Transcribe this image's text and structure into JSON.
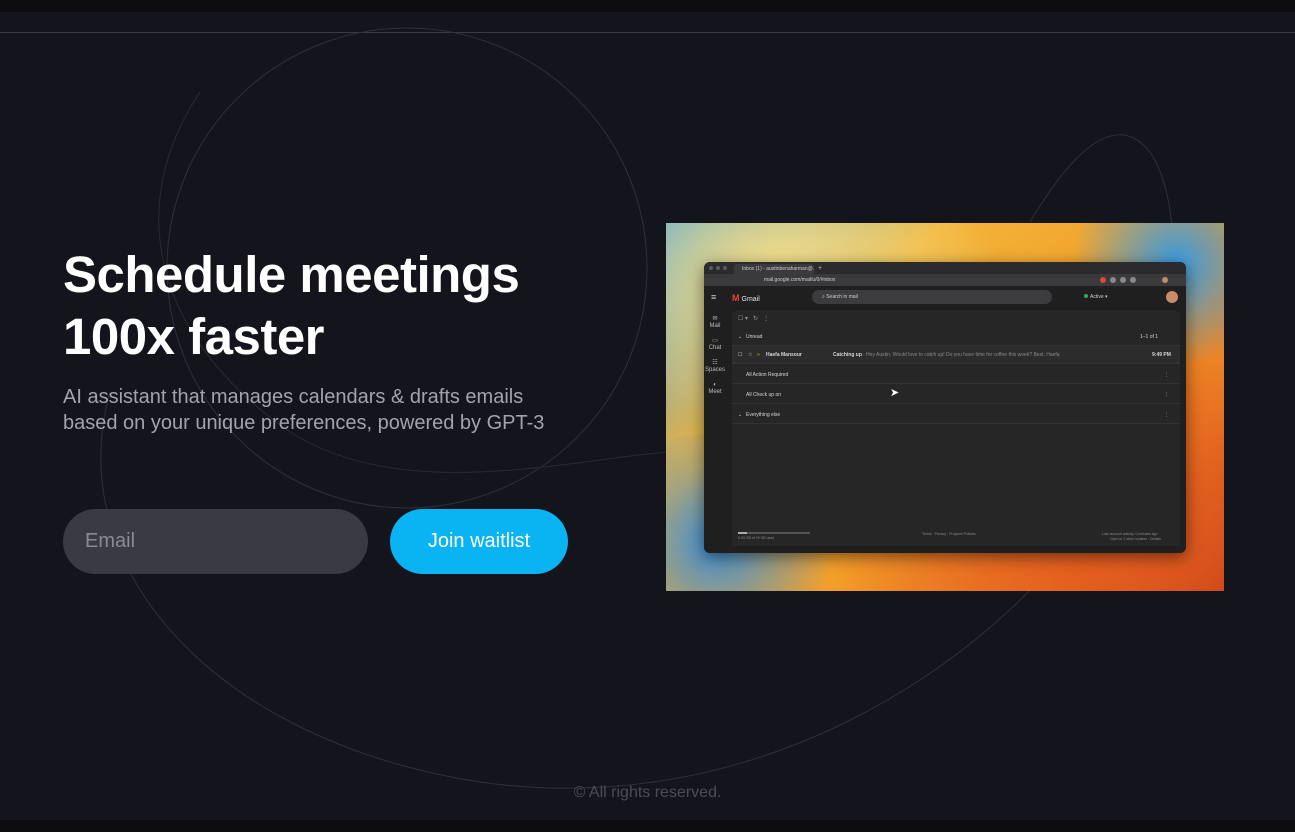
{
  "hero": {
    "title_line1": "Schedule meetings",
    "title_line2": "100x faster",
    "subtitle": "AI assistant that manages calendars & drafts emails based on your unique preferences, powered by GPT-3"
  },
  "form": {
    "email_placeholder": "Email",
    "join_label": "Join waitlist"
  },
  "footer": {
    "text": "© All rights reserved."
  },
  "colors": {
    "background": "#14141c",
    "cta": "#0ab4f2",
    "input": "#3a3a42",
    "title": "#ffffff",
    "subtitle": "#a3a3ad"
  },
  "preview": {
    "tab_title": "Inbox (1) - austinbenaharman@...",
    "url": "mail.google.com/mail/u/0/#inbox",
    "app_name": "Gmail",
    "search_placeholder": "Search in mail",
    "status": "Active",
    "sidebar": [
      {
        "icon": "mail-icon",
        "label": "Mail"
      },
      {
        "icon": "chat-icon",
        "label": "Chat"
      },
      {
        "icon": "spaces-icon",
        "label": "Spaces"
      },
      {
        "icon": "meet-icon",
        "label": "Meet"
      }
    ],
    "sections": {
      "unread": "Unread",
      "unread_count": "1–1 of 1",
      "action_required": "All Action Required",
      "check_up": "All Check up on",
      "everything_else": "Everything else"
    },
    "email": {
      "sender": "Haefa Mansour",
      "subject": "Catching up",
      "snippet": "- Hey Austin, Would love to catch up! Do you have time for coffee this week? Best, Haefa",
      "time": "9:49 PM"
    },
    "footer": {
      "storage": "0.03 GB of 15 GB used",
      "storage_fraction": 0.12,
      "links": "Terms · Privacy · Program Policies",
      "activity": "Last account activity: 0 minutes ago",
      "sessions": "Open in 1 other location · Details"
    }
  }
}
